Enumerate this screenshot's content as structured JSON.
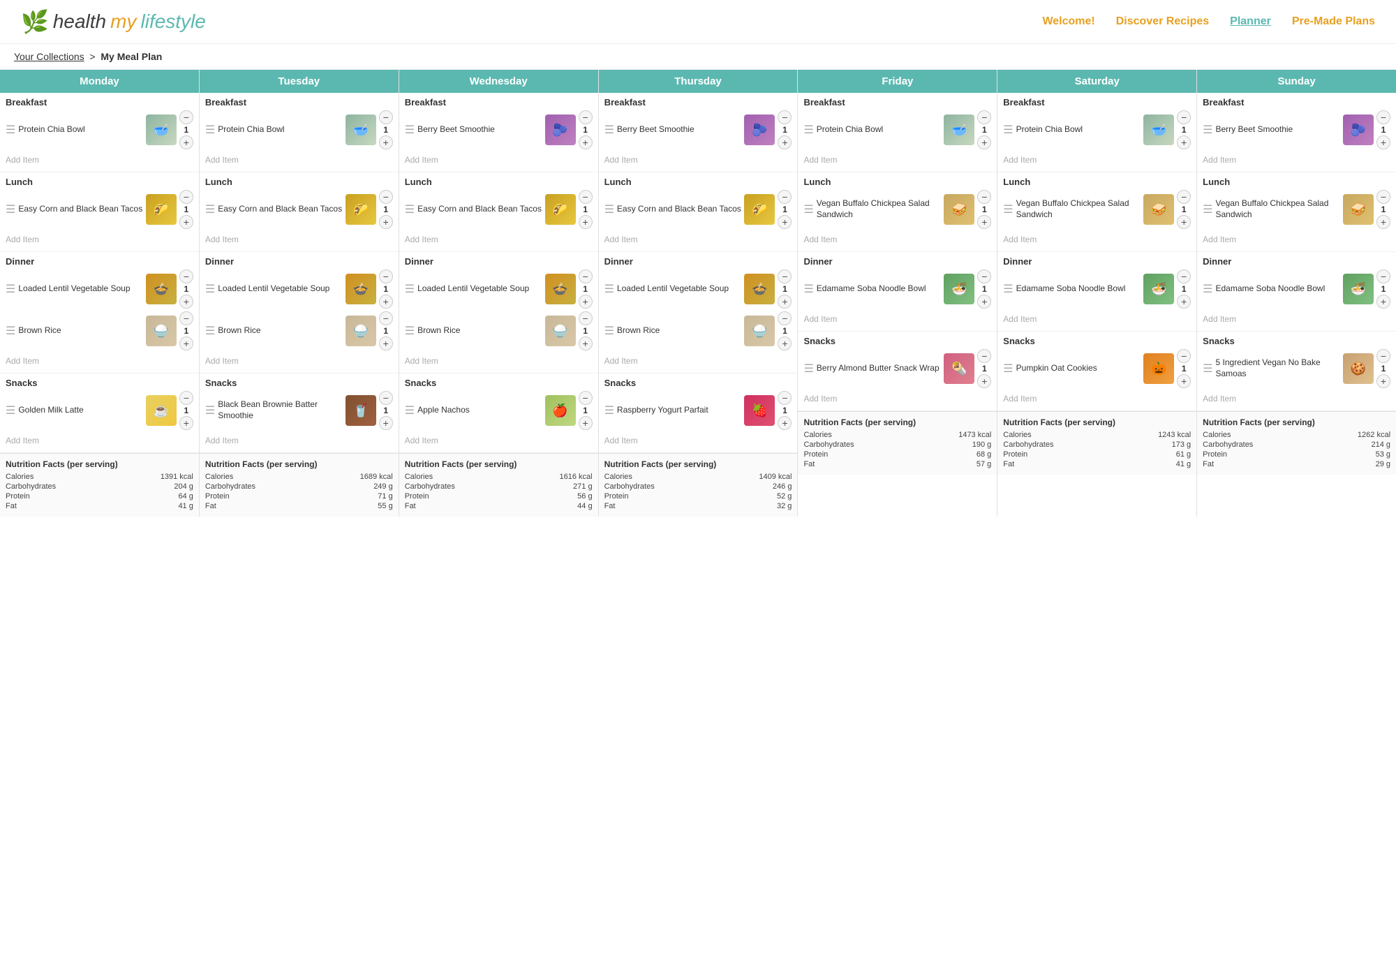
{
  "header": {
    "logo_health": "health",
    "logo_my": "my",
    "logo_lifestyle": "lifestyle",
    "nav": {
      "welcome": "Welcome!",
      "discover": "Discover Recipes",
      "planner": "Planner",
      "premade": "Pre-Made Plans"
    }
  },
  "breadcrumb": {
    "collections": "Your Collections",
    "current": "My Meal Plan"
  },
  "days": [
    {
      "name": "Monday",
      "breakfast": {
        "items": [
          {
            "name": "Protein Chia Bowl",
            "qty": 1,
            "imgClass": "img-chia",
            "emoji": "🥣"
          }
        ]
      },
      "lunch": {
        "items": [
          {
            "name": "Easy Corn and Black Bean Tacos",
            "qty": 1,
            "imgClass": "img-corn",
            "emoji": "🌮"
          }
        ]
      },
      "dinner": {
        "items": [
          {
            "name": "Loaded Lentil Vegetable Soup",
            "qty": 1,
            "imgClass": "img-lentil",
            "emoji": "🍲"
          },
          {
            "name": "Brown Rice",
            "qty": 1,
            "imgClass": "img-brown-rice",
            "emoji": "🍚"
          }
        ]
      },
      "snacks": {
        "items": [
          {
            "name": "Golden Milk Latte",
            "qty": 1,
            "imgClass": "img-golden-milk",
            "emoji": "☕"
          }
        ]
      },
      "nutrition": {
        "title": "Nutrition Facts (per serving)",
        "calories": "1391 kcal",
        "carbs": "204 g",
        "protein": "64 g",
        "fat": "41 g"
      }
    },
    {
      "name": "Tuesday",
      "breakfast": {
        "items": [
          {
            "name": "Protein Chia Bowl",
            "qty": 1,
            "imgClass": "img-chia",
            "emoji": "🥣"
          }
        ]
      },
      "lunch": {
        "items": [
          {
            "name": "Easy Corn and Black Bean Tacos",
            "qty": 1,
            "imgClass": "img-corn",
            "emoji": "🌮"
          }
        ]
      },
      "dinner": {
        "items": [
          {
            "name": "Loaded Lentil Vegetable Soup",
            "qty": 1,
            "imgClass": "img-lentil",
            "emoji": "🍲"
          },
          {
            "name": "Brown Rice",
            "qty": 1,
            "imgClass": "img-brown-rice",
            "emoji": "🍚"
          }
        ]
      },
      "snacks": {
        "items": [
          {
            "name": "Black Bean Brownie Batter Smoothie",
            "qty": 1,
            "imgClass": "img-black-bean",
            "emoji": "🥤"
          }
        ]
      },
      "nutrition": {
        "title": "Nutrition Facts (per serving)",
        "calories": "1689 kcal",
        "carbs": "249 g",
        "protein": "71 g",
        "fat": "55 g"
      }
    },
    {
      "name": "Wednesday",
      "breakfast": {
        "items": [
          {
            "name": "Berry Beet Smoothie",
            "qty": 1,
            "imgClass": "img-berry-beet",
            "emoji": "🫐"
          }
        ]
      },
      "lunch": {
        "items": [
          {
            "name": "Easy Corn and Black Bean Tacos",
            "qty": 1,
            "imgClass": "img-corn",
            "emoji": "🌮"
          }
        ]
      },
      "dinner": {
        "items": [
          {
            "name": "Loaded Lentil Vegetable Soup",
            "qty": 1,
            "imgClass": "img-lentil",
            "emoji": "🍲"
          },
          {
            "name": "Brown Rice",
            "qty": 1,
            "imgClass": "img-brown-rice",
            "emoji": "🍚"
          }
        ]
      },
      "snacks": {
        "items": [
          {
            "name": "Apple Nachos",
            "qty": 1,
            "imgClass": "img-apple-nachos",
            "emoji": "🍎"
          }
        ]
      },
      "nutrition": {
        "title": "Nutrition Facts (per serving)",
        "calories": "1616 kcal",
        "carbs": "271 g",
        "protein": "56 g",
        "fat": "44 g"
      }
    },
    {
      "name": "Thursday",
      "breakfast": {
        "items": [
          {
            "name": "Berry Beet Smoothie",
            "qty": 1,
            "imgClass": "img-berry-beet",
            "emoji": "🫐"
          }
        ]
      },
      "lunch": {
        "items": [
          {
            "name": "Easy Corn and Black Bean Tacos",
            "qty": 1,
            "imgClass": "img-corn",
            "emoji": "🌮"
          }
        ]
      },
      "dinner": {
        "items": [
          {
            "name": "Loaded Lentil Vegetable Soup",
            "qty": 1,
            "imgClass": "img-lentil",
            "emoji": "🍲"
          },
          {
            "name": "Brown Rice",
            "qty": 1,
            "imgClass": "img-brown-rice",
            "emoji": "🍚"
          }
        ]
      },
      "snacks": {
        "items": [
          {
            "name": "Raspberry Yogurt Parfait",
            "qty": 1,
            "imgClass": "img-raspberry",
            "emoji": "🍓"
          }
        ]
      },
      "nutrition": {
        "title": "Nutrition Facts (per serving)",
        "calories": "1409 kcal",
        "carbs": "246 g",
        "protein": "52 g",
        "fat": "32 g"
      }
    },
    {
      "name": "Friday",
      "breakfast": {
        "items": [
          {
            "name": "Protein Chia Bowl",
            "qty": 1,
            "imgClass": "img-chia",
            "emoji": "🥣"
          }
        ]
      },
      "lunch": {
        "items": [
          {
            "name": "Vegan Buffalo Chickpea Salad Sandwich",
            "qty": 1,
            "imgClass": "img-chickpea",
            "emoji": "🥪"
          }
        ]
      },
      "dinner": {
        "items": [
          {
            "name": "Edamame Soba Noodle Bowl",
            "qty": 1,
            "imgClass": "img-edamame",
            "emoji": "🍜"
          }
        ]
      },
      "snacks": {
        "items": [
          {
            "name": "Berry Almond Butter Snack Wrap",
            "qty": 1,
            "imgClass": "img-berry-wrap",
            "emoji": "🌯"
          }
        ]
      },
      "nutrition": {
        "title": "Nutrition Facts (per serving)",
        "calories": "1473 kcal",
        "carbs": "190 g",
        "protein": "68 g",
        "fat": "57 g"
      }
    },
    {
      "name": "Saturday",
      "breakfast": {
        "items": [
          {
            "name": "Protein Chia Bowl",
            "qty": 1,
            "imgClass": "img-chia",
            "emoji": "🥣"
          }
        ]
      },
      "lunch": {
        "items": [
          {
            "name": "Vegan Buffalo Chickpea Salad Sandwich",
            "qty": 1,
            "imgClass": "img-chickpea",
            "emoji": "🥪"
          }
        ]
      },
      "dinner": {
        "items": [
          {
            "name": "Edamame Soba Noodle Bowl",
            "qty": 1,
            "imgClass": "img-edamame",
            "emoji": "🍜"
          }
        ]
      },
      "snacks": {
        "items": [
          {
            "name": "Pumpkin Oat Cookies",
            "qty": 1,
            "imgClass": "img-pumpkin",
            "emoji": "🎃"
          }
        ]
      },
      "nutrition": {
        "title": "Nutrition Facts (per serving)",
        "calories": "1243 kcal",
        "carbs": "173 g",
        "protein": "61 g",
        "fat": "41 g"
      }
    },
    {
      "name": "Sunday",
      "breakfast": {
        "items": [
          {
            "name": "Berry Beet Smoothie",
            "qty": 1,
            "imgClass": "img-berry-beet",
            "emoji": "🫐"
          }
        ]
      },
      "lunch": {
        "items": [
          {
            "name": "Vegan Buffalo Chickpea Salad Sandwich",
            "qty": 1,
            "imgClass": "img-chickpea",
            "emoji": "🥪"
          }
        ]
      },
      "dinner": {
        "items": [
          {
            "name": "Edamame Soba Noodle Bowl",
            "qty": 1,
            "imgClass": "img-edamame",
            "emoji": "🍜"
          }
        ]
      },
      "snacks": {
        "items": [
          {
            "name": "5 Ingredient Vegan No Bake Samoas",
            "qty": 1,
            "imgClass": "img-5ing",
            "emoji": "🍪"
          }
        ]
      },
      "nutrition": {
        "title": "Nutrition Facts (per serving)",
        "calories": "1262 kcal",
        "carbs": "214 g",
        "protein": "53 g",
        "fat": "29 g"
      }
    }
  ],
  "labels": {
    "breakfast": "Breakfast",
    "lunch": "Lunch",
    "dinner": "Dinner",
    "snacks": "Snacks",
    "add_item": "Add Item",
    "calories_label": "Calories",
    "carbs_label": "Carbohydrates",
    "protein_label": "Protein",
    "fat_label": "Fat"
  }
}
